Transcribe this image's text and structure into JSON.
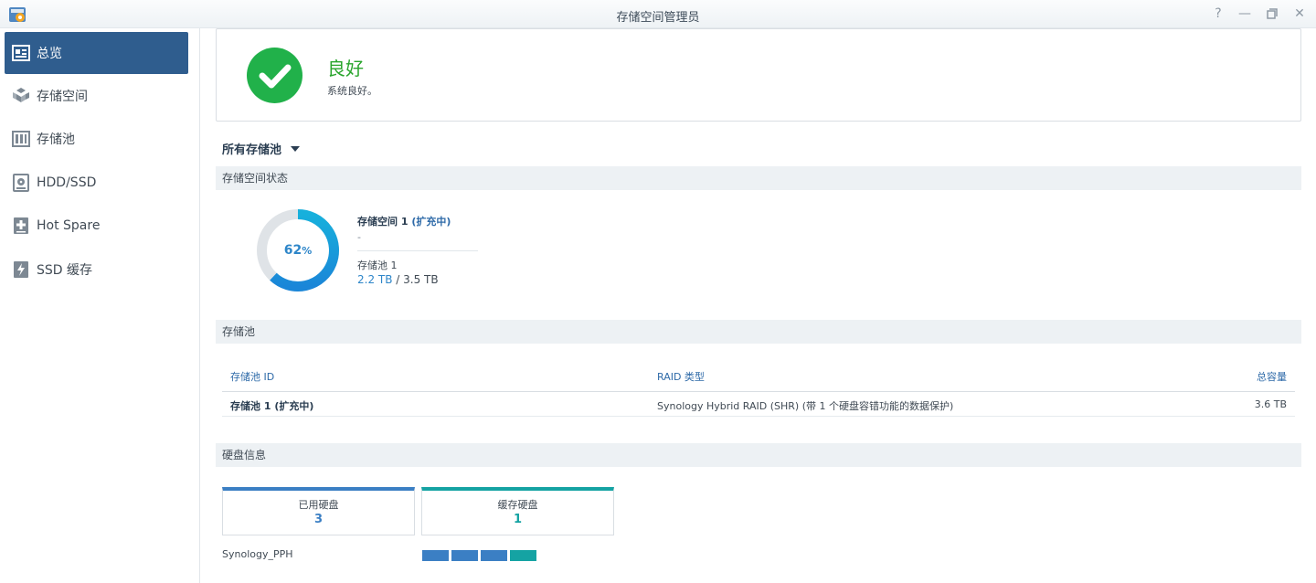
{
  "window": {
    "title": "存储空间管理员",
    "controls": [
      "help",
      "minimize",
      "maximize",
      "close"
    ]
  },
  "sidebar": {
    "items": [
      {
        "label": "总览",
        "icon": "overview-icon",
        "active": true
      },
      {
        "label": "存储空间",
        "icon": "storage-volume-icon",
        "active": false
      },
      {
        "label": "存储池",
        "icon": "storage-pool-icon",
        "active": false
      },
      {
        "label": "HDD/SSD",
        "icon": "hdd-icon",
        "active": false
      },
      {
        "label": "Hot Spare",
        "icon": "hot-spare-icon",
        "active": false
      },
      {
        "label": "SSD 缓存",
        "icon": "ssd-cache-icon",
        "active": false
      }
    ]
  },
  "status": {
    "title": "良好",
    "description": "系统良好。",
    "color": "#21b14a"
  },
  "filter": {
    "label": "所有存储池"
  },
  "volume_section": {
    "heading": "存储空间状态",
    "usage_percent": 62,
    "usage_percent_value": "62",
    "usage_percent_sign": "%",
    "volume_name": "存储空间 1",
    "volume_state": "(扩充中)",
    "volume_dash": "-",
    "pool_name": "存储池 1",
    "used": "2.2 TB",
    "separator": " / ",
    "total": "3.5 TB"
  },
  "pool_section": {
    "heading": "存储池",
    "columns": [
      "存储池 ID",
      "RAID 类型",
      "总容量"
    ],
    "rows": [
      {
        "id": "存储池 1 (扩充中)",
        "raid": "Synology Hybrid RAID (SHR) (带 1 个硬盘容错功能的数据保护)",
        "capacity": "3.6 TB"
      }
    ]
  },
  "disk_section": {
    "heading": "硬盘信息",
    "used_disks": {
      "label": "已用硬盘",
      "count": "3",
      "color": "#3b7fc4"
    },
    "cache_disks": {
      "label": "缓存硬盘",
      "count": "1",
      "color": "#15a3a3"
    },
    "host": "Synology_PPH",
    "slots": [
      "used",
      "used",
      "used",
      "cache"
    ]
  }
}
